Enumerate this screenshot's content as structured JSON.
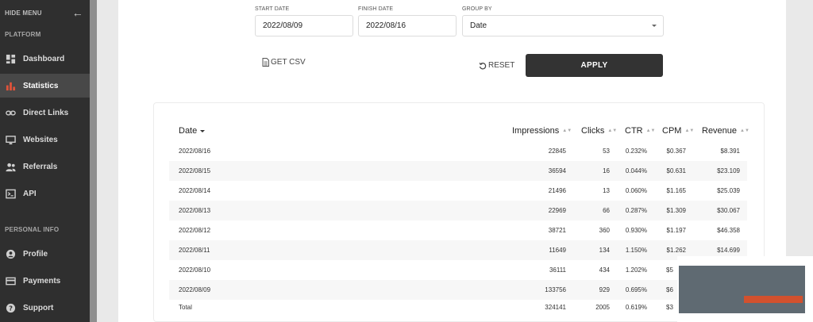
{
  "sidebar": {
    "hide_menu": "HIDE MENU",
    "platform_label": "PLATFORM",
    "personal_label": "PERSONAL INFO",
    "items": [
      {
        "label": "Dashboard",
        "icon": "dashboard-icon"
      },
      {
        "label": "Statistics",
        "icon": "bar-chart-icon",
        "active": true
      },
      {
        "label": "Direct Links",
        "icon": "link-icon"
      },
      {
        "label": "Websites",
        "icon": "monitor-icon"
      },
      {
        "label": "Referrals",
        "icon": "users-icon"
      },
      {
        "label": "API",
        "icon": "terminal-icon"
      }
    ],
    "personal_items": [
      {
        "label": "Profile",
        "icon": "user-circle-icon"
      },
      {
        "label": "Payments",
        "icon": "credit-card-icon"
      },
      {
        "label": "Support",
        "icon": "help-circle-icon"
      }
    ],
    "accent_color": "#e0533a"
  },
  "filters": {
    "start_label": "START DATE",
    "start_value": "2022/08/09",
    "finish_label": "FINISH DATE",
    "finish_value": "2022/08/16",
    "group_label": "GROUP BY",
    "group_value": "Date"
  },
  "actions": {
    "csv": "GET CSV",
    "reset": "RESET",
    "apply": "APPLY"
  },
  "table": {
    "headers": {
      "date": "Date",
      "impressions": "Impressions",
      "clicks": "Clicks",
      "ctr": "CTR",
      "cpm": "CPM",
      "revenue": "Revenue"
    },
    "rows": [
      {
        "date": "2022/08/16",
        "impressions": "22845",
        "clicks": "53",
        "ctr": "0.232%",
        "cpm": "$0.367",
        "revenue": "$8.391"
      },
      {
        "date": "2022/08/15",
        "impressions": "36594",
        "clicks": "16",
        "ctr": "0.044%",
        "cpm": "$0.631",
        "revenue": "$23.109"
      },
      {
        "date": "2022/08/14",
        "impressions": "21496",
        "clicks": "13",
        "ctr": "0.060%",
        "cpm": "$1.165",
        "revenue": "$25.039"
      },
      {
        "date": "2022/08/13",
        "impressions": "22969",
        "clicks": "66",
        "ctr": "0.287%",
        "cpm": "$1.309",
        "revenue": "$30.067"
      },
      {
        "date": "2022/08/12",
        "impressions": "38721",
        "clicks": "360",
        "ctr": "0.930%",
        "cpm": "$1.197",
        "revenue": "$46.358"
      },
      {
        "date": "2022/08/11",
        "impressions": "11649",
        "clicks": "134",
        "ctr": "1.150%",
        "cpm": "$1.262",
        "revenue": "$14.699"
      },
      {
        "date": "2022/08/10",
        "impressions": "36111",
        "clicks": "434",
        "ctr": "1.202%",
        "cpm": "$5",
        "revenue": ""
      },
      {
        "date": "2022/08/09",
        "impressions": "133756",
        "clicks": "929",
        "ctr": "0.695%",
        "cpm": "$6",
        "revenue": ""
      }
    ],
    "total": {
      "date": "Total",
      "impressions": "324141",
      "clicks": "2005",
      "ctr": "0.619%",
      "cpm": "$3",
      "revenue": ""
    }
  }
}
